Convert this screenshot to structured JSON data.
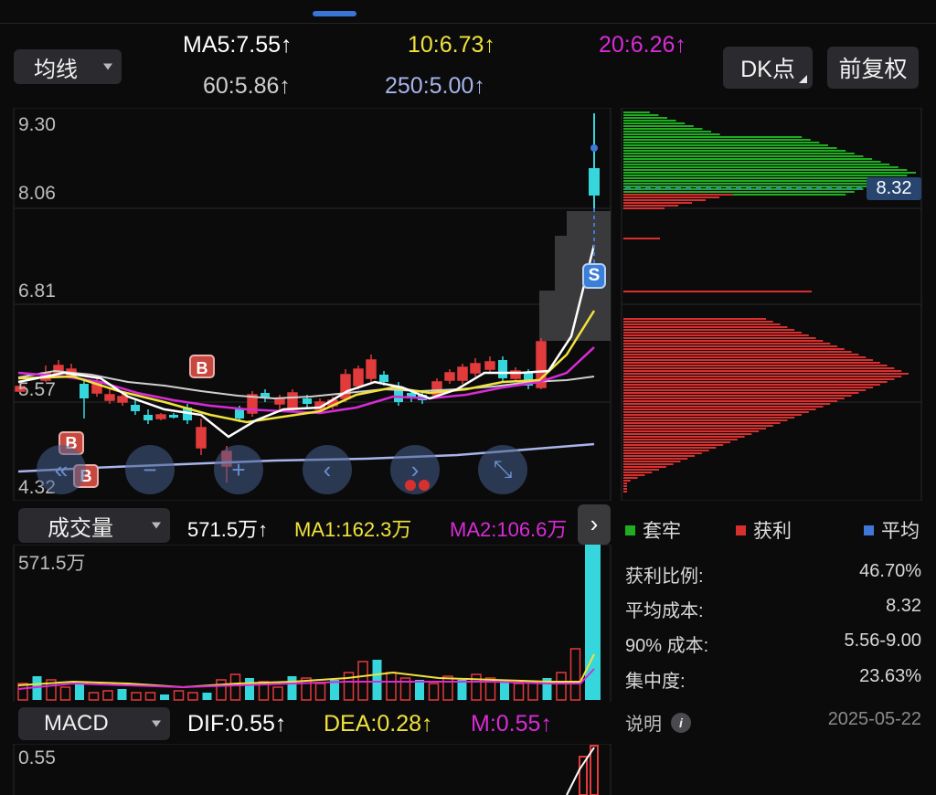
{
  "header": {
    "ma_selector": "均线",
    "ma5": "MA5:7.55",
    "ma10": "10:6.73",
    "ma20": "20:6.26",
    "ma60": "60:5.86",
    "ma250": "250:5.00",
    "up_arrow": "↑",
    "dk_button": "DK点",
    "adjust_button": "前复权"
  },
  "colors": {
    "up": "#e23b3b",
    "down": "#35d6dc",
    "ma5": "#ffffff",
    "ma10": "#f0e33c",
    "ma20": "#d82bd6",
    "ma60": "#cfcfcf",
    "ma250": "#a8b4ea",
    "profit": "#d8302f",
    "trapped": "#1fae1f",
    "average": "#3f78d8"
  },
  "price_chart": {
    "y_labels": [
      "9.30",
      "8.06",
      "6.81",
      "5.57",
      "4.32"
    ],
    "current_price_tag": "8.32",
    "signals": [
      "B",
      "B",
      "B",
      "S"
    ]
  },
  "volume": {
    "selector": "成交量",
    "value": "571.5万",
    "ma1": "MA1:162.3万",
    "ma2": "MA2:106.6万",
    "y_label": "571.5万"
  },
  "macd": {
    "selector": "MACD",
    "dif": "DIF:0.55",
    "dea": "DEA:0.28",
    "m": "M:0.55",
    "y_label": "0.55"
  },
  "chip": {
    "legend": [
      "套牢",
      "获利",
      "平均"
    ],
    "stats": [
      {
        "label": "获利比例:",
        "value": "46.70%"
      },
      {
        "label": "平均成本:",
        "value": "8.32"
      },
      {
        "label": "90% 成本:",
        "value": "5.56-9.00"
      },
      {
        "label": "集中度:",
        "value": "23.63%"
      }
    ],
    "note_label": "说明",
    "date": "2025-05-22"
  },
  "nav_buttons": [
    "rewind-icon",
    "zoom-out-icon",
    "zoom-in-icon",
    "prev-icon",
    "next-icon",
    "fullscreen-icon"
  ]
}
